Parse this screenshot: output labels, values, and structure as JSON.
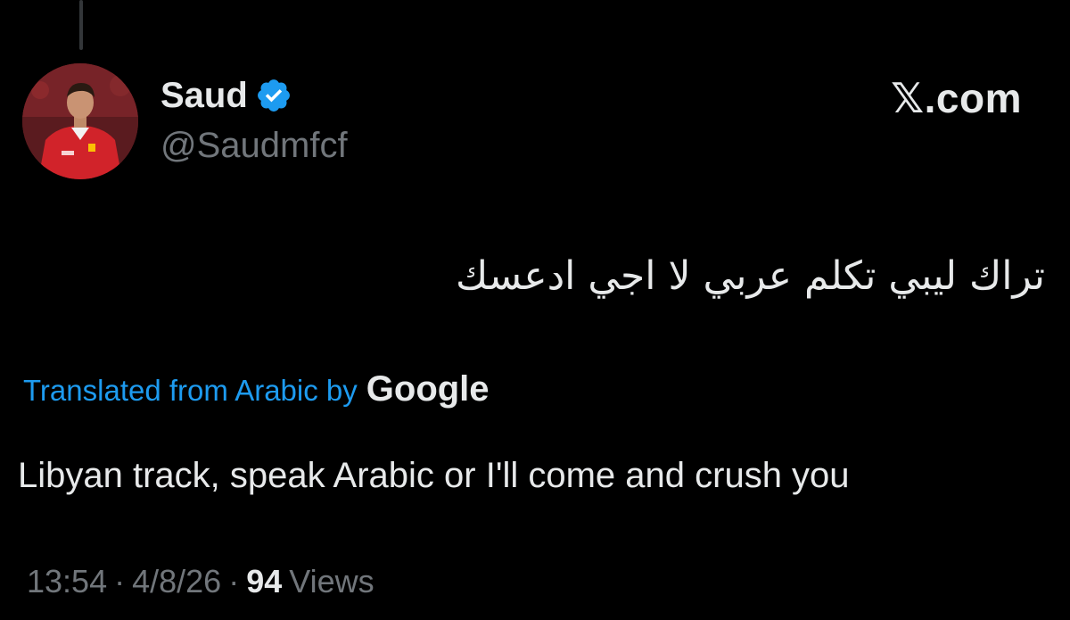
{
  "colors": {
    "background": "#000000",
    "text": "#e7e9ea",
    "secondary": "#71767b",
    "link": "#1d9bf0",
    "verified": "#1d9bf0"
  },
  "author": {
    "display_name": "Saud",
    "handle": "@Saudmfcf",
    "verified": true
  },
  "brand": "𝕏.com",
  "tweet": {
    "text_original": "تراك ليبي تكلم عربي لا اجي ادعسك",
    "translated_label": "Translated from Arabic by",
    "translator": "Google",
    "text_translated": "Libyan track, speak Arabic or I'll come and crush you"
  },
  "meta": {
    "time": "13:54",
    "separator": "·",
    "date": "4/8/26",
    "views_count": "94",
    "views_label": "Views"
  }
}
